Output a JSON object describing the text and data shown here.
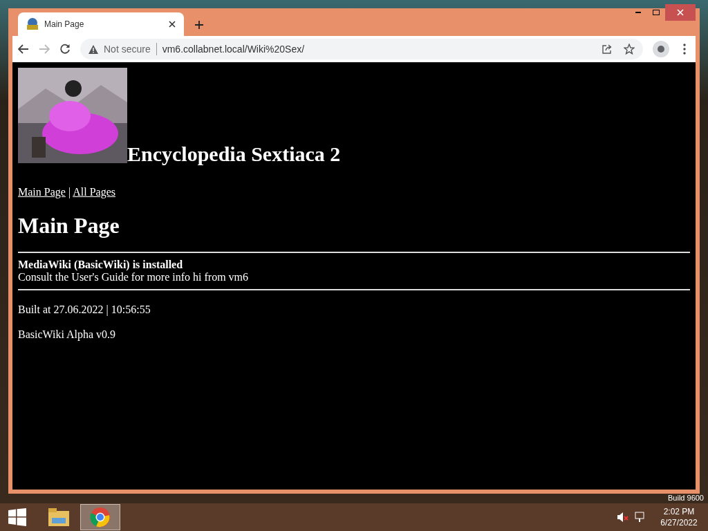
{
  "browser": {
    "tab": {
      "title": "Main Page",
      "selected": true
    },
    "address_bar": {
      "security": "Not secure",
      "url": "vm6.collabnet.local/Wiki%20Sex/"
    }
  },
  "page": {
    "site_title": "Encyclopedia Sextiaca 2",
    "nav_links": [
      {
        "label": "Main Page"
      },
      {
        "label": "All Pages"
      }
    ],
    "nav_separator": "|",
    "heading": "Main Page",
    "notice": {
      "title": "MediaWiki (BasicWiki) is installed",
      "text": "Consult the User's Guide for more info hi from vm6"
    },
    "built": "Built at 27.06.2022 | 10:56:55",
    "version": "BasicWiki Alpha v0.9"
  },
  "desktop": {
    "build": "Build 9600"
  },
  "taskbar": {
    "apps": [
      {
        "kind": "explorer",
        "selected": false
      },
      {
        "kind": "chrome",
        "selected": true
      }
    ],
    "time": "2:02 PM",
    "date": "6/27/2022"
  }
}
